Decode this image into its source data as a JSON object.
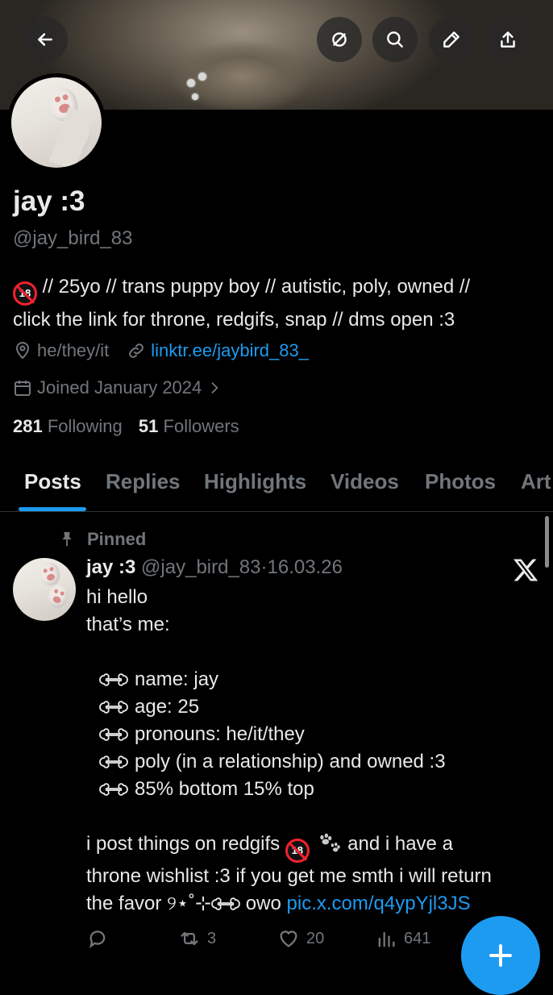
{
  "header": {
    "back_icon": "arrow-left-icon",
    "actions": [
      "rainbow-off-icon",
      "search-icon",
      "edit-icon",
      "share-icon"
    ]
  },
  "profile": {
    "name": "jay :3",
    "handle": "@jay_bird_83",
    "bio_line1": " // 25yo // trans puppy boy // autistic, poly, owned //",
    "bio_line2": "click the link for throne, redgifs, snap // dms open :3",
    "bio_emoji": "18",
    "pronouns": "he/they/it",
    "link": "linktr.ee/jaybird_83_",
    "joined": "Joined January 2024",
    "following_count": "281",
    "following_label": "Following",
    "followers_count": "51",
    "followers_label": "Followers"
  },
  "tabs": [
    "Posts",
    "Replies",
    "Highlights",
    "Videos",
    "Photos",
    "Art"
  ],
  "active_tab": "Posts",
  "post": {
    "pinned_label": "Pinned",
    "author": "jay :3",
    "handle": "@jay_bird_83",
    "separator": "·",
    "date": "16.03.26",
    "line1": "hi hello",
    "line2": "that’s me:",
    "list": [
      "name: jay",
      "age: 25",
      "pronouns: he/it/they",
      "poly (in a relationship) and owned :3",
      "85% bottom 15% top"
    ],
    "para_a": "i post things on redgifs ",
    "para_b": " and i have a",
    "para_line2": "throne wishlist :3 if you get me smth i will return",
    "para_line3_a": "the favor ୨⋆˚⊹",
    "para_line3_b": " owo ",
    "media_link": "pic.x.com/q4ypYjl3JS",
    "replies": "",
    "reposts": "3",
    "likes": "20",
    "views": "641"
  },
  "fab_icon": "plus-icon",
  "colors": {
    "accent": "#1d9bf0",
    "background": "#000000",
    "text": "#e7e9ea",
    "muted": "#71767b"
  }
}
